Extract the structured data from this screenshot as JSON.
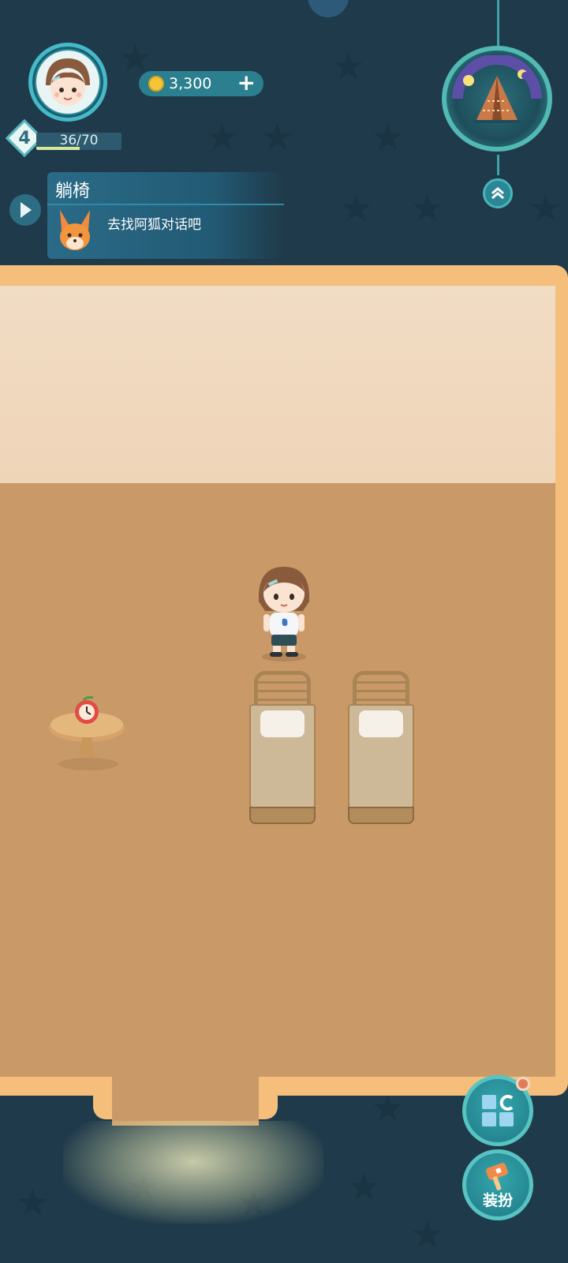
{
  "hud": {
    "level": "4",
    "xp_text": "36/70",
    "xp_progress": 0.51,
    "coins": "3,300",
    "coin_add_label": "+"
  },
  "quest": {
    "title": "躺椅",
    "text": "去找阿狐对话吧"
  },
  "buttons": {
    "dress_label": "装扮"
  },
  "icons": {
    "avatar": "player-avatar-icon",
    "coin": "coin-icon",
    "quest_toggle": "play-arrow-icon",
    "quest_npc": "fox-icon",
    "medallion": "tent-night-icon",
    "collapse": "double-chevron-up-icon",
    "build": "build-blocks-icon",
    "dress": "hammer-icon"
  },
  "colors": {
    "background": "#1f3a4a",
    "room_border": "#f5be7a",
    "floor": "#c99a68",
    "wall": "#f1dcc4",
    "accent": "#2c7f8e"
  }
}
